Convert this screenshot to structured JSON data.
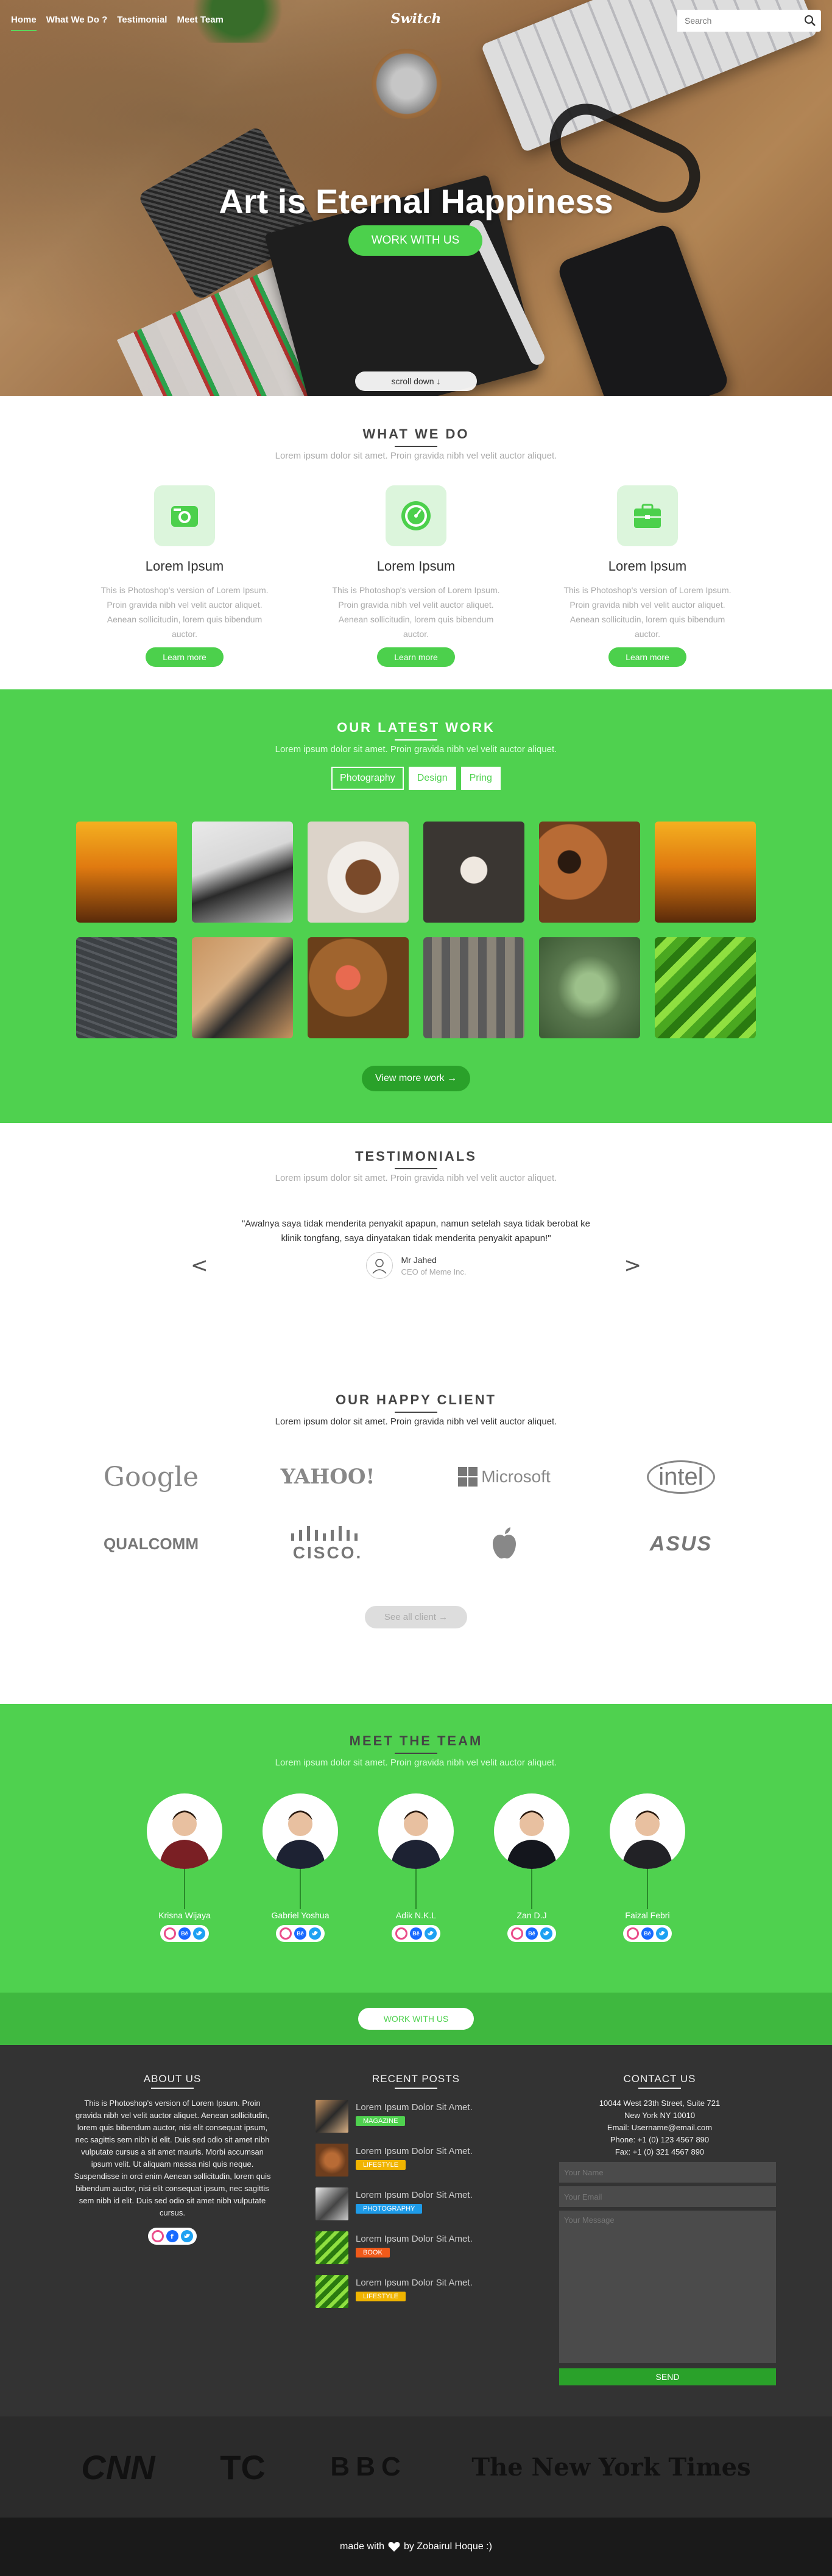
{
  "nav": {
    "links": [
      "Home",
      "What We Do ?",
      "Testimonial",
      "Meet Team"
    ],
    "logo": "Switch",
    "search_placeholder": "Search"
  },
  "hero": {
    "title": "Art is Eternal Happiness",
    "cta": "WORK WITH US",
    "scroll": "scroll down"
  },
  "what": {
    "title": "WHAT WE DO",
    "subtitle": "Lorem ipsum dolor sit amet. Proin gravida nibh vel velit auctor aliquet.",
    "items": [
      {
        "icon": "camera-icon",
        "title": "Lorem Ipsum",
        "text": "This is Photoshop's version of Lorem Ipsum. Proin gravida nibh vel velit auctor aliquet. Aenean sollicitudin, lorem quis bibendum auctor.",
        "button": "Learn more"
      },
      {
        "icon": "speedometer-icon",
        "title": "Lorem Ipsum",
        "text": "This is Photoshop's version of Lorem Ipsum. Proin gravida nibh vel velit auctor aliquet. Aenean sollicitudin, lorem quis bibendum auctor.",
        "button": "Learn more"
      },
      {
        "icon": "briefcase-icon",
        "title": "Lorem Ipsum",
        "text": "This is Photoshop's version of Lorem Ipsum. Proin gravida nibh vel velit auctor aliquet. Aenean sollicitudin, lorem quis bibendum auctor.",
        "button": "Learn more"
      }
    ]
  },
  "work": {
    "title": "OUR LATEST WORK",
    "subtitle": "Lorem ipsum dolor sit amet. Proin gravida nibh vel velit auctor aliquet.",
    "filters": [
      "Photography",
      "Design",
      "Pring"
    ],
    "view_more": "View more work"
  },
  "testimonials": {
    "title": "TESTIMONIALS",
    "subtitle": "Lorem ipsum dolor sit amet. Proin gravida nibh vel velit auctor aliquet.",
    "quote": "\"Awalnya saya tidak menderita penyakit apapun, namun setelah saya tidak berobat ke klinik tongfang, saya dinyatakan tidak menderita penyakit apapun!\"",
    "author": "Mr Jahed",
    "role": "CEO of Meme Inc.",
    "prev": "<",
    "next": ">"
  },
  "clients": {
    "title": "OUR HAPPY CLIENT",
    "subtitle": "Lorem ipsum dolor sit amet. Proin gravida nibh vel velit auctor aliquet.",
    "logos": [
      "Google",
      "YAHOO!",
      "Microsoft",
      "intel",
      "QUALCOMM",
      "CISCO.",
      "apple",
      "ASUS"
    ],
    "see_all": "See all client"
  },
  "team": {
    "title": "MEET THE TEAM",
    "subtitle": "Lorem ipsum dolor sit amet. Proin gravida nibh vel velit auctor aliquet.",
    "members": [
      {
        "name": "Krisna Wijaya",
        "shirt": "#7a1f24"
      },
      {
        "name": "Gabriel Yoshua",
        "shirt": "#1d2233"
      },
      {
        "name": "Adik N.K.L",
        "shirt": "#1d2233"
      },
      {
        "name": "Zan D.J",
        "shirt": "#14161d"
      },
      {
        "name": "Faizal Febri",
        "shirt": "#222226"
      }
    ],
    "cta": "WORK WITH US"
  },
  "footer": {
    "about_title": "ABOUT US",
    "about_text": "This is Photoshop's version of Lorem Ipsum. Proin gravida nibh vel velit auctor aliquet. Aenean sollicitudin, lorem quis bibendum auctor, nisi elit consequat ipsum, nec sagittis sem nibh id elit. Duis sed odio sit amet nibh vulputate cursus a sit amet mauris. Morbi accumsan ipsum velit. Ut aliquam massa nisl quis neque. Suspendisse in orci enim Aenean sollicitudin, lorem quis bibendum auctor, nisi elit consequat ipsum, nec sagittis sem nibh id elit. Duis sed odio sit amet nibh vulputate cursus.",
    "posts_title": "RECENT POSTS",
    "posts": [
      {
        "title": "Lorem Ipsum Dolor Sit Amet.",
        "tag": "MAGAZINE",
        "color": "#4fd14f"
      },
      {
        "title": "Lorem Ipsum Dolor Sit Amet.",
        "tag": "LIFESTYLE",
        "color": "#f0b400"
      },
      {
        "title": "Lorem Ipsum Dolor Sit Amet.",
        "tag": "PHOTOGRAPHY",
        "color": "#1e9be8"
      },
      {
        "title": "Lorem Ipsum Dolor Sit Amet.",
        "tag": "BOOK",
        "color": "#f05a1a"
      },
      {
        "title": "Lorem Ipsum Dolor Sit Amet.",
        "tag": "LIFESTYLE",
        "color": "#f0b400"
      }
    ],
    "contact_title": "CONTACT US",
    "address1": "10044 West 23th Street, Suite 721",
    "address2": "New York NY 10010",
    "email": "Email: Username@email.com",
    "phone": "Phone: +1 (0) 123 4567 890",
    "fax": "Fax: +1 (0) 321 4567 890",
    "name_placeholder": "Your Name",
    "email_placeholder": "Your Email",
    "message_placeholder": "Your Message",
    "send": "SEND"
  },
  "press": [
    "CNN",
    "TC",
    "BBC",
    "The New York Times"
  ],
  "credit": "by Zobairul Hoque :)",
  "credit_prefix": "made with"
}
